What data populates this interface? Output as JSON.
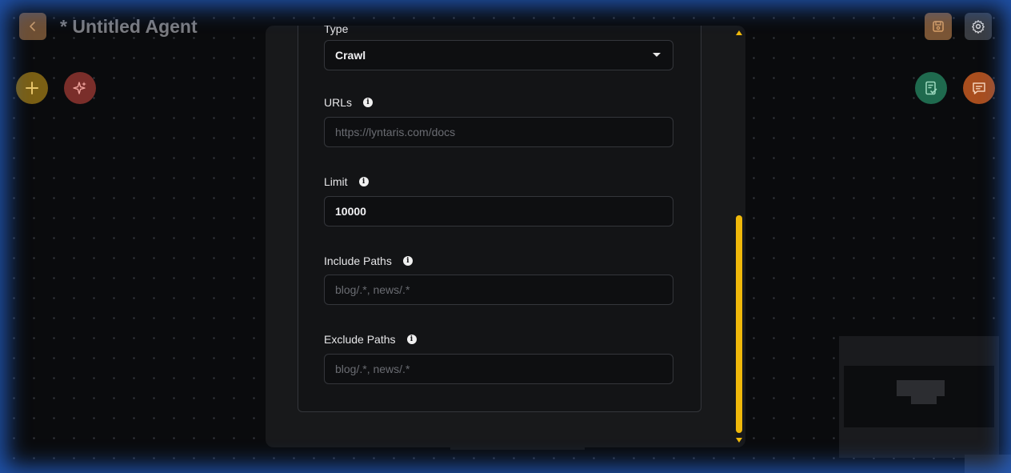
{
  "header": {
    "title": "* Untitled Agent",
    "back_icon": "chevron-left-icon",
    "save_icon": "save-icon",
    "settings_icon": "gear-icon"
  },
  "toolbar": {
    "add_icon": "plus-icon",
    "magic_icon": "sparkles-icon",
    "validate_icon": "checklist-icon",
    "chat_icon": "chat-icon"
  },
  "form": {
    "type": {
      "label": "Type",
      "value": "Crawl"
    },
    "urls": {
      "label": "URLs",
      "placeholder": "https://lyntaris.com/docs"
    },
    "limit": {
      "label": "Limit",
      "value": "10000"
    },
    "include_paths": {
      "label": "Include Paths",
      "placeholder": "blog/.*, news/.*"
    },
    "exclude_paths": {
      "label": "Exclude Paths",
      "placeholder": "blog/.*, news/.*"
    }
  },
  "colors": {
    "accent": "#f0b90b",
    "add": "#7a5f14",
    "magic": "#7a2e2a",
    "validate": "#1f6a4e",
    "chat": "#a94e1e",
    "frame_glow": "#286ee6"
  }
}
